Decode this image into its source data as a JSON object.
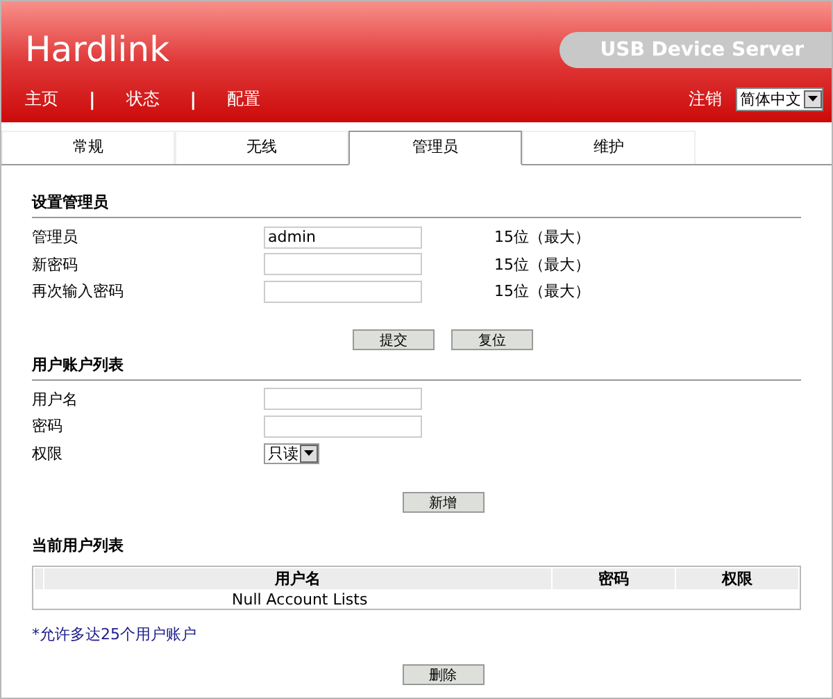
{
  "header": {
    "logo": "Hardlink",
    "product": "USB Device Server",
    "logout": "注销",
    "language": "简体中文"
  },
  "nav": [
    {
      "kind": "link",
      "label": "主页"
    },
    {
      "kind": "separator",
      "label": "|"
    },
    {
      "kind": "link",
      "label": "状态"
    },
    {
      "kind": "separator",
      "label": "|"
    },
    {
      "kind": "link",
      "label": "配置"
    }
  ],
  "tabs": [
    {
      "label": "常规",
      "selected": false
    },
    {
      "label": "无线",
      "selected": false
    },
    {
      "label": "管理员",
      "selected": true
    },
    {
      "label": "维护",
      "selected": false
    }
  ],
  "admin_section": {
    "title": "设置管理员",
    "fields": [
      {
        "label": "管理员",
        "value": "admin",
        "hint": "15位（最大）"
      },
      {
        "label": "新密码",
        "hint": "15位（最大）"
      },
      {
        "label": "再次输入密码",
        "hint": "15位（最大）"
      }
    ],
    "buttons": [
      "提交",
      "复位"
    ]
  },
  "user_section": {
    "title": "用户账户列表",
    "fields": [
      {
        "kind": "text",
        "label": "用户名"
      },
      {
        "kind": "text",
        "label": "密码"
      },
      {
        "kind": "select",
        "label": "权限",
        "value": "只读"
      }
    ],
    "buttons": [
      "新增"
    ]
  },
  "current_users": {
    "title": "当前用户列表",
    "columns": [
      "用户名",
      "密码",
      "权限"
    ],
    "empty_text": "Null Account Lists",
    "note": "*允许多达25个用户账户",
    "buttons": [
      "删除"
    ]
  }
}
